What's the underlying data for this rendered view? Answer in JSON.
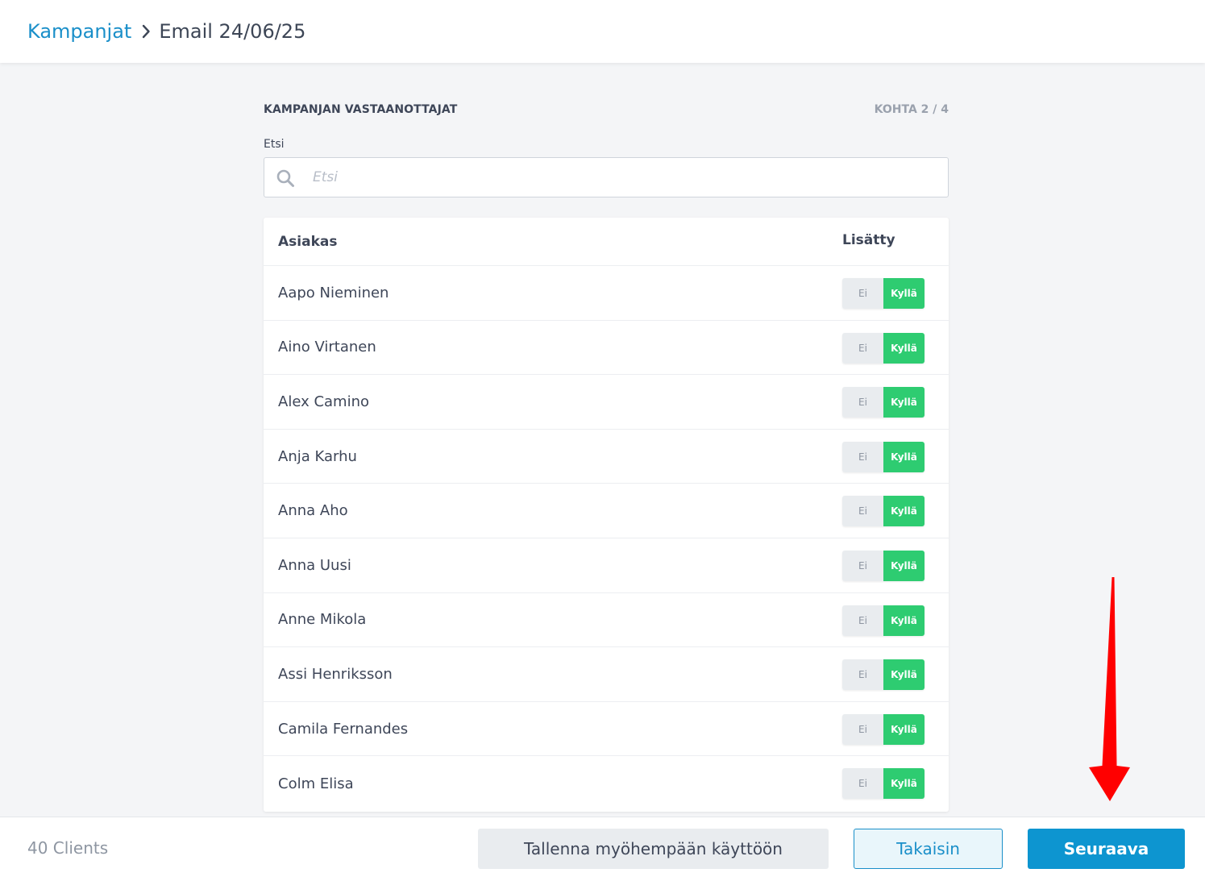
{
  "breadcrumb": {
    "parent": "Kampanjat",
    "current": "Email 24/06/25"
  },
  "section": {
    "title": "KAMPANJAN VASTAANOTTAJAT",
    "step": "KOHTA 2 / 4"
  },
  "search": {
    "label": "Etsi",
    "placeholder": "Etsi",
    "value": ""
  },
  "table": {
    "headers": {
      "client": "Asiakas",
      "added": "Lisätty"
    },
    "toggle_labels": {
      "no": "Ei",
      "yes": "Kyllä"
    },
    "rows": [
      {
        "name": "Aapo Nieminen",
        "added": "Kyllä"
      },
      {
        "name": "Aino Virtanen",
        "added": "Kyllä"
      },
      {
        "name": "Alex Camino",
        "added": "Kyllä"
      },
      {
        "name": "Anja Karhu",
        "added": "Kyllä"
      },
      {
        "name": "Anna Aho",
        "added": "Kyllä"
      },
      {
        "name": "Anna Uusi",
        "added": "Kyllä"
      },
      {
        "name": "Anne Mikola",
        "added": "Kyllä"
      },
      {
        "name": "Assi Henriksson",
        "added": "Kyllä"
      },
      {
        "name": "Camila Fernandes",
        "added": "Kyllä"
      },
      {
        "name": "Colm Elisa",
        "added": "Kyllä"
      }
    ]
  },
  "footer": {
    "count": "40 Clients",
    "save_label": "Tallenna myöhempään käyttöön",
    "back_label": "Takaisin",
    "next_label": "Seuraava"
  },
  "colors": {
    "accent": "#1a8fc9",
    "primary_button": "#0d95d0",
    "toggle_on": "#2ecc71",
    "annotation_arrow": "#ff0000"
  },
  "icons": {
    "breadcrumb_separator": "chevron-right-icon",
    "search": "search-icon",
    "annotation": "red-arrow-icon"
  }
}
